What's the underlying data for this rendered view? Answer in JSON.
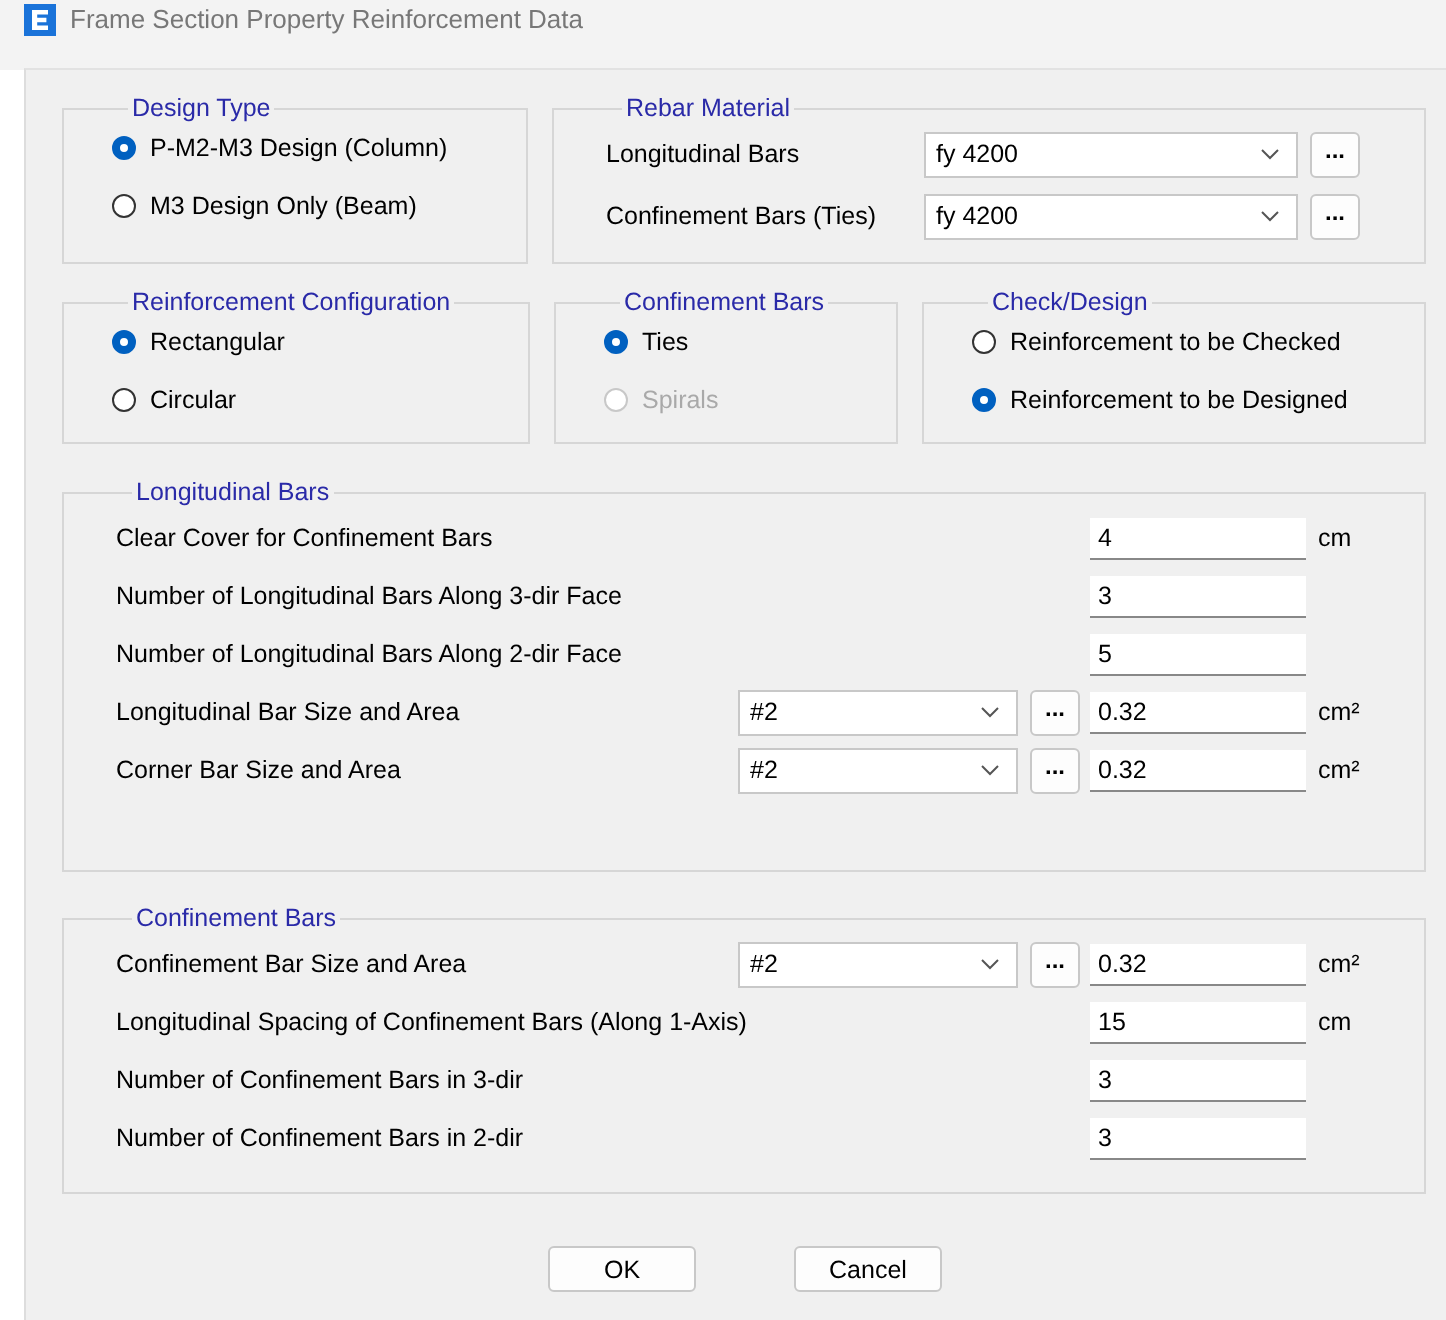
{
  "window": {
    "title": "Frame Section Property Reinforcement Data"
  },
  "design_type": {
    "title": "Design Type",
    "options": [
      {
        "label": "P-M2-M3 Design  (Column)",
        "selected": true
      },
      {
        "label": "M3 Design Only  (Beam)",
        "selected": false
      }
    ]
  },
  "rebar_material": {
    "title": "Rebar Material",
    "rows": [
      {
        "label": "Longitudinal Bars",
        "value": "fy 4200",
        "button": "..."
      },
      {
        "label": "Confinement Bars (Ties)",
        "value": "fy 4200",
        "button": "..."
      }
    ]
  },
  "reinforcement_configuration": {
    "title": "Reinforcement Configuration",
    "options": [
      {
        "label": "Rectangular",
        "selected": true,
        "disabled": false
      },
      {
        "label": "Circular",
        "selected": false,
        "disabled": false
      }
    ]
  },
  "confinement_bar_type": {
    "title": "Confinement Bars",
    "options": [
      {
        "label": "Ties",
        "selected": true,
        "disabled": false
      },
      {
        "label": "Spirals",
        "selected": false,
        "disabled": true
      }
    ]
  },
  "check_design": {
    "title": "Check/Design",
    "options": [
      {
        "label": "Reinforcement to be Checked",
        "selected": false,
        "disabled": false
      },
      {
        "label": "Reinforcement to be Designed",
        "selected": true,
        "disabled": false
      }
    ]
  },
  "longitudinal_bars": {
    "title": "Longitudinal Bars",
    "rows": [
      {
        "kind": "field",
        "label": "Clear Cover for Confinement Bars",
        "value": "4",
        "unit": "cm"
      },
      {
        "kind": "field",
        "label": "Number of Longitudinal Bars Along 3-dir Face",
        "value": "3"
      },
      {
        "kind": "field",
        "label": "Number of Longitudinal Bars Along 2-dir Face",
        "value": "5"
      },
      {
        "kind": "combo",
        "label": "Longitudinal Bar Size and Area",
        "size": "#2",
        "button": "...",
        "value": "0.32",
        "unit": "cm²"
      },
      {
        "kind": "combo",
        "label": "Corner Bar Size and Area",
        "size": "#2",
        "button": "...",
        "value": "0.32",
        "unit": "cm²"
      }
    ]
  },
  "confinement_bars": {
    "title": "Confinement Bars",
    "rows": [
      {
        "kind": "combo",
        "label": "Confinement Bar Size and Area",
        "size": "#2",
        "button": "...",
        "value": "0.32",
        "unit": "cm²"
      },
      {
        "kind": "field",
        "label": "Longitudinal Spacing of Confinement Bars  (Along 1-Axis)",
        "value": "15",
        "unit": "cm"
      },
      {
        "kind": "field",
        "label": "Number of Confinement Bars in 3-dir",
        "value": "3"
      },
      {
        "kind": "field",
        "label": "Number of Confinement Bars in 2-dir",
        "value": "3"
      }
    ]
  },
  "buttons": [
    "OK",
    "Cancel"
  ]
}
